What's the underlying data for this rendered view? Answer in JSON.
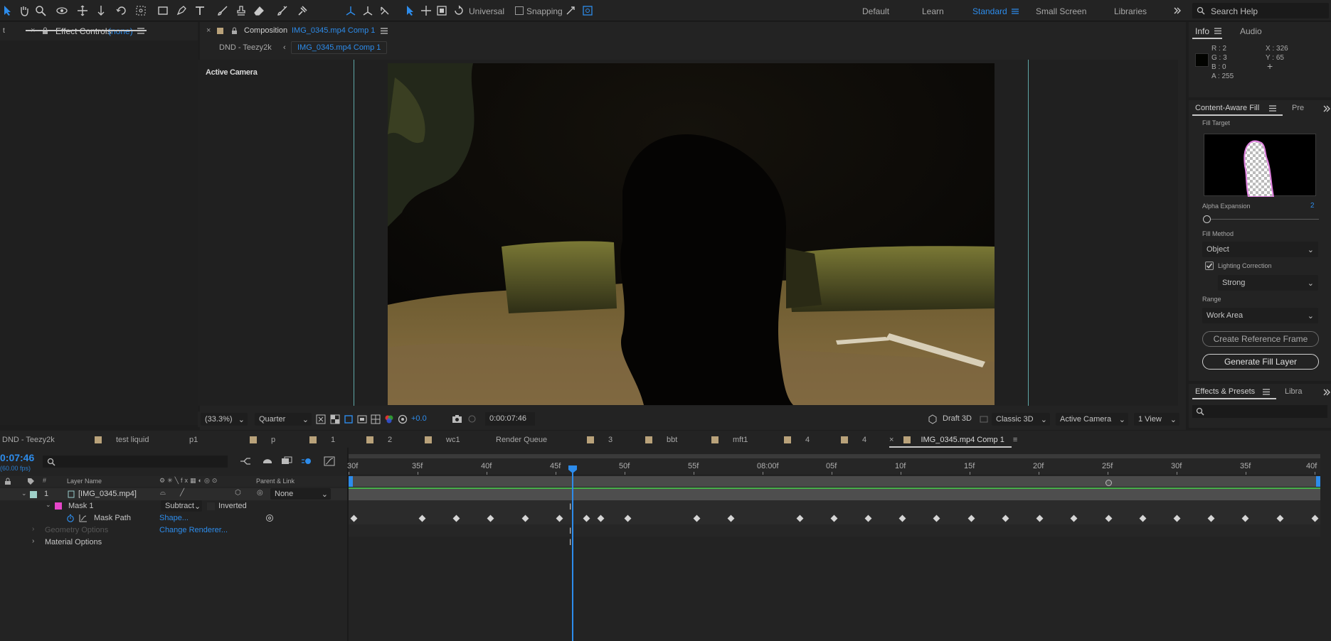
{
  "toolbar": {
    "universal": "Universal",
    "snapping": "Snapping",
    "workspaces": [
      "Default",
      "Learn",
      "Standard",
      "Small Screen",
      "Libraries"
    ],
    "active_workspace": "Standard",
    "search_placeholder": "Search Help"
  },
  "effect_controls": {
    "tab_label": "Effect Controls",
    "tab_suffix": "(none)"
  },
  "composition": {
    "tab_prefix": "Composition",
    "tab_name": "IMG_0345.mp4 Comp 1",
    "breadcrumb_parent": "DND - Teezy2k",
    "breadcrumb_current": "IMG_0345.mp4 Comp 1",
    "active_camera_label": "Active Camera",
    "magnification": "(33.3%)",
    "resolution": "Quarter",
    "exposure": "+0.0",
    "timecode": "0:00:07:46",
    "renderer": "Draft 3D",
    "renderer_mode": "Classic 3D",
    "camera": "Active Camera",
    "views": "1 View"
  },
  "info": {
    "tab_info": "Info",
    "tab_audio": "Audio",
    "r": "R : 2",
    "g": "G : 3",
    "b": "B : 0",
    "a": "A :  255",
    "x": "X : 326",
    "y": "Y : 65"
  },
  "content_aware_fill": {
    "tab_label": "Content-Aware Fill",
    "tab_next": "Pre",
    "fill_target_label": "Fill Target",
    "alpha_expansion_label": "Alpha Expansion",
    "alpha_expansion_value": "2",
    "alpha_expansion_level": 0,
    "fill_method_label": "Fill Method",
    "fill_method_value": "Object",
    "lighting_correction_label": "Lighting Correction",
    "lighting_correction_checked": true,
    "lighting_value": "Strong",
    "range_label": "Range",
    "range_value": "Work Area",
    "create_ref_button": "Create Reference Frame",
    "generate_button": "Generate Fill Layer"
  },
  "effects_presets": {
    "tab_label": "Effects & Presets",
    "tab_next": "Libra"
  },
  "timeline": {
    "tabs": [
      {
        "label": "DND - Teezy2k",
        "swatch": false
      },
      {
        "label": "test liquid",
        "swatch": true
      },
      {
        "label": "p1",
        "swatch": false
      },
      {
        "label": "p",
        "swatch": true
      },
      {
        "label": "1",
        "swatch": true
      },
      {
        "label": "2",
        "swatch": true
      },
      {
        "label": "wc1",
        "swatch": true
      },
      {
        "label": "Render Queue",
        "swatch": false
      },
      {
        "label": "3",
        "swatch": true
      },
      {
        "label": "bbt",
        "swatch": true
      },
      {
        "label": "mft1",
        "swatch": true
      },
      {
        "label": "4",
        "swatch": true
      },
      {
        "label": "4",
        "swatch": true
      }
    ],
    "active_tab": "IMG_0345.mp4 Comp 1",
    "timecode": "0:07:46",
    "fps": "(60.00 fps)",
    "col_layer_name": "Layer Name",
    "col_parent": "Parent & Link",
    "layer_number": "1",
    "layer_name": "[IMG_0345.mp4]",
    "parent_value": "None",
    "mask_name": "Mask 1",
    "mask_mode": "Subtract",
    "inverted_label": "Inverted",
    "mask_path_label": "Mask Path",
    "mask_path_value": "Shape...",
    "geometry_label": "Geometry Options",
    "change_renderer": "Change Renderer...",
    "material_label": "Material Options",
    "ruler_labels": [
      "30f",
      "35f",
      "40f",
      "45f",
      "50f",
      "55f",
      "08:00f",
      "05f",
      "10f",
      "15f",
      "20f",
      "25f",
      "30f",
      "35f",
      "40f"
    ]
  }
}
